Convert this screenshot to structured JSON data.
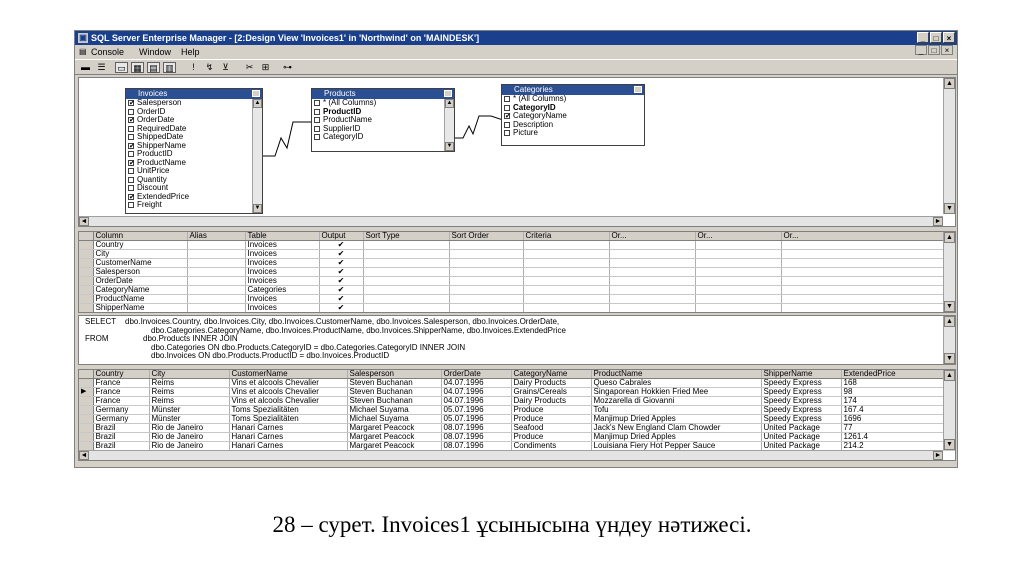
{
  "window": {
    "title": "SQL Server Enterprise Manager - [2:Design View 'Invoices1' in 'Northwind' on 'MAINDESK']",
    "controls": [
      "_",
      "□",
      "×"
    ]
  },
  "menu": {
    "console": "Console",
    "window": "Window",
    "help": "Help"
  },
  "tables": {
    "invoices": {
      "title": "Invoices",
      "columns": [
        {
          "name": "Salesperson",
          "checked": true
        },
        {
          "name": "OrderID",
          "checked": false
        },
        {
          "name": "OrderDate",
          "checked": true
        },
        {
          "name": "RequiredDate",
          "checked": false
        },
        {
          "name": "ShippedDate",
          "checked": false
        },
        {
          "name": "ShipperName",
          "checked": true
        },
        {
          "name": "ProductID",
          "checked": false
        },
        {
          "name": "ProductName",
          "checked": true
        },
        {
          "name": "UnitPrice",
          "checked": false
        },
        {
          "name": "Quantity",
          "checked": false
        },
        {
          "name": "Discount",
          "checked": false
        },
        {
          "name": "ExtendedPrice",
          "checked": true
        },
        {
          "name": "Freight",
          "checked": false
        }
      ]
    },
    "products": {
      "title": "Products",
      "columns": [
        {
          "name": "* (All Columns)",
          "checked": false,
          "bold": false
        },
        {
          "name": "ProductID",
          "checked": false,
          "bold": true
        },
        {
          "name": "ProductName",
          "checked": false,
          "bold": false
        },
        {
          "name": "SupplierID",
          "checked": false,
          "bold": false
        },
        {
          "name": "CategoryID",
          "checked": false,
          "bold": false
        }
      ]
    },
    "categories": {
      "title": "Categories",
      "columns": [
        {
          "name": "* (All Columns)",
          "checked": false,
          "bold": false
        },
        {
          "name": "CategoryID",
          "checked": false,
          "bold": true
        },
        {
          "name": "CategoryName",
          "checked": true,
          "bold": false
        },
        {
          "name": "Description",
          "checked": false,
          "bold": false
        },
        {
          "name": "Picture",
          "checked": false,
          "bold": false
        }
      ]
    }
  },
  "grid": {
    "headers": [
      "Column",
      "Alias",
      "Table",
      "Output",
      "Sort Type",
      "Sort Order",
      "Criteria",
      "Or...",
      "Or...",
      "Or..."
    ],
    "rows": [
      {
        "column": "Country",
        "table": "Invoices",
        "output": "✔"
      },
      {
        "column": "City",
        "table": "Invoices",
        "output": "✔"
      },
      {
        "column": "CustomerName",
        "table": "Invoices",
        "output": "✔"
      },
      {
        "column": "Salesperson",
        "table": "Invoices",
        "output": "✔"
      },
      {
        "column": "OrderDate",
        "table": "Invoices",
        "output": "✔"
      },
      {
        "column": "CategoryName",
        "table": "Categories",
        "output": "✔"
      },
      {
        "column": "ProductName",
        "table": "Invoices",
        "output": "✔"
      },
      {
        "column": "ShipperName",
        "table": "Invoices",
        "output": "✔"
      }
    ]
  },
  "sql": {
    "select_kw": "SELECT",
    "select_1": "dbo.Invoices.Country, dbo.Invoices.City, dbo.Invoices.CustomerName, dbo.Invoices.Salesperson, dbo.Invoices.OrderDate,",
    "select_2": "dbo.Categories.CategoryName, dbo.Invoices.ProductName, dbo.Invoices.ShipperName, dbo.Invoices.ExtendedPrice",
    "from_kw": "FROM",
    "from_1": "dbo.Products INNER JOIN",
    "from_2": "dbo.Categories ON dbo.Products.CategoryID = dbo.Categories.CategoryID INNER JOIN",
    "from_3": "dbo.Invoices ON dbo.Products.ProductID = dbo.Invoices.ProductID"
  },
  "results": {
    "headers": [
      "Country",
      "City",
      "CustomerName",
      "Salesperson",
      "OrderDate",
      "CategoryName",
      "ProductName",
      "ShipperName",
      "ExtendedPrice"
    ],
    "rows": [
      [
        "France",
        "Reims",
        "Vins et alcools Chevalier",
        "Steven Buchanan",
        "04.07.1996",
        "Dairy Products",
        "Queso Cabrales",
        "Speedy Express",
        "168"
      ],
      [
        "France",
        "Reims",
        "Vins et alcools Chevalier",
        "Steven Buchanan",
        "04.07.1996",
        "Grains/Cereals",
        "Singaporean Hokkien Fried Mee",
        "Speedy Express",
        "98"
      ],
      [
        "France",
        "Reims",
        "Vins et alcools Chevalier",
        "Steven Buchanan",
        "04.07.1996",
        "Dairy Products",
        "Mozzarella di Giovanni",
        "Speedy Express",
        "174"
      ],
      [
        "Germany",
        "Münster",
        "Toms Spezialitäten",
        "Michael Suyama",
        "05.07.1996",
        "Produce",
        "Tofu",
        "Speedy Express",
        "167.4"
      ],
      [
        "Germany",
        "Münster",
        "Toms Spezialitäten",
        "Michael Suyama",
        "05.07.1996",
        "Produce",
        "Manjimup Dried Apples",
        "Speedy Express",
        "1696"
      ],
      [
        "Brazil",
        "Rio de Janeiro",
        "Hanari Carnes",
        "Margaret Peacock",
        "08.07.1996",
        "Seafood",
        "Jack's New England Clam Chowder",
        "United Package",
        "77"
      ],
      [
        "Brazil",
        "Rio de Janeiro",
        "Hanari Carnes",
        "Margaret Peacock",
        "08.07.1996",
        "Produce",
        "Manjimup Dried Apples",
        "United Package",
        "1261.4"
      ],
      [
        "Brazil",
        "Rio de Janeiro",
        "Hanari Carnes",
        "Margaret Peacock",
        "08.07.1996",
        "Condiments",
        "Louisiana Fiery Hot Pepper Sauce",
        "United Package",
        "214.2"
      ]
    ],
    "current_row": 1
  },
  "caption": "28 – сурет. Invoices1 ұсынысына үндеу нәтижесі."
}
